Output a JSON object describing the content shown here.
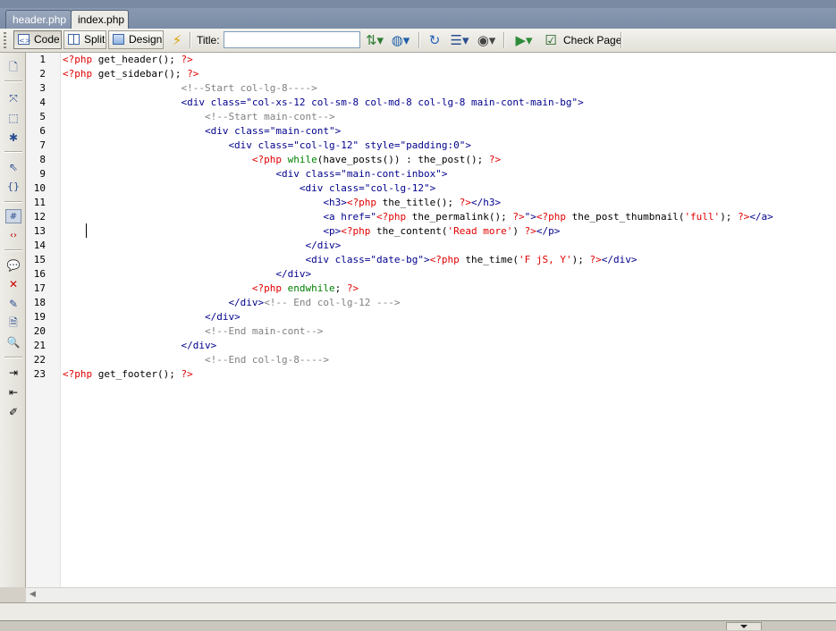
{
  "tabs": [
    {
      "label": "header.php",
      "active": false
    },
    {
      "label": "index.php",
      "active": true
    }
  ],
  "toolbar": {
    "code_label": "Code",
    "split_label": "Split",
    "design_label": "Design",
    "title_label": "Title:",
    "title_value": "",
    "check_page_label": "Check Page",
    "icons": [
      "live-view-icon",
      "file-management-icon",
      "browser-preview-icon",
      "refresh-icon",
      "view-options-icon",
      "visual-aids-icon",
      "validate-icon",
      "check-page-icon"
    ]
  },
  "left_toolbar": {
    "icons": [
      "open-documents-icon",
      "collapse-full-tag-icon",
      "collapse-selection-icon",
      "expand-all-icon",
      "select-parent-tag-icon",
      "balance-braces-icon",
      "line-numbers-icon",
      "highlight-invalid-code-icon",
      "apply-comment-icon",
      "remove-comment-icon",
      "wrap-tag-icon",
      "recent-snippets-icon",
      "move-css-icon",
      "indent-code-icon",
      "outdent-code-icon",
      "format-source-code-icon"
    ]
  },
  "editor": {
    "line_numbers": [
      "1",
      "2",
      "3",
      "4",
      "5",
      "6",
      "7",
      "8",
      "9",
      "10",
      "11",
      "12",
      "13",
      "14",
      "15",
      "16",
      "17",
      "18",
      "19",
      "20",
      "21",
      "22",
      "23"
    ],
    "lines": [
      [
        {
          "t": "php",
          "v": "<?php"
        },
        {
          "t": "plain",
          "v": " get_header(); "
        },
        {
          "t": "php",
          "v": "?>"
        }
      ],
      [
        {
          "t": "php",
          "v": "<?php"
        },
        {
          "t": "plain",
          "v": " get_sidebar(); "
        },
        {
          "t": "php",
          "v": "?>"
        }
      ],
      [
        {
          "t": "plain",
          "v": "                    "
        },
        {
          "t": "cmt",
          "v": "<!--Start col-lg-8---->"
        }
      ],
      [
        {
          "t": "plain",
          "v": "                    "
        },
        {
          "t": "tag",
          "v": "<div class=\"col-xs-12 col-sm-8 col-md-8 col-lg-8 main-cont-main-bg\">"
        }
      ],
      [
        {
          "t": "plain",
          "v": "                        "
        },
        {
          "t": "cmt",
          "v": "<!--Start main-cont-->"
        }
      ],
      [
        {
          "t": "plain",
          "v": "                        "
        },
        {
          "t": "tag",
          "v": "<div class=\"main-cont\">"
        }
      ],
      [
        {
          "t": "plain",
          "v": "                            "
        },
        {
          "t": "tag",
          "v": "<div class=\"col-lg-12\" style=\"padding:0\">"
        }
      ],
      [
        {
          "t": "plain",
          "v": "                                "
        },
        {
          "t": "php",
          "v": "<?php"
        },
        {
          "t": "plain",
          "v": " "
        },
        {
          "t": "kw",
          "v": "while"
        },
        {
          "t": "plain",
          "v": "(have_posts()) : the_post(); "
        },
        {
          "t": "php",
          "v": "?>"
        }
      ],
      [
        {
          "t": "plain",
          "v": "                                    "
        },
        {
          "t": "tag",
          "v": "<div class=\"main-cont-inbox\">"
        }
      ],
      [
        {
          "t": "plain",
          "v": "                                        "
        },
        {
          "t": "tag",
          "v": "<div class=\"col-lg-12\">"
        }
      ],
      [
        {
          "t": "plain",
          "v": "                                            "
        },
        {
          "t": "tag",
          "v": "<h3>"
        },
        {
          "t": "php",
          "v": "<?php"
        },
        {
          "t": "plain",
          "v": " the_title(); "
        },
        {
          "t": "php",
          "v": "?>"
        },
        {
          "t": "tag",
          "v": "</h3>"
        }
      ],
      [
        {
          "t": "plain",
          "v": "                                            "
        },
        {
          "t": "tag",
          "v": "<a href=\""
        },
        {
          "t": "php",
          "v": "<?php"
        },
        {
          "t": "plain",
          "v": " the_permalink(); "
        },
        {
          "t": "php",
          "v": "?>"
        },
        {
          "t": "tag",
          "v": "\">"
        },
        {
          "t": "php",
          "v": "<?php"
        },
        {
          "t": "plain",
          "v": " the_post_thumbnail("
        },
        {
          "t": "php",
          "v": "'full'"
        },
        {
          "t": "plain",
          "v": "); "
        },
        {
          "t": "php",
          "v": "?>"
        },
        {
          "t": "tag",
          "v": "</a>"
        }
      ],
      [
        {
          "t": "plain",
          "v": "                                            "
        },
        {
          "t": "tag",
          "v": "<p>"
        },
        {
          "t": "php",
          "v": "<?php"
        },
        {
          "t": "plain",
          "v": " the_content("
        },
        {
          "t": "php",
          "v": "'Read more'"
        },
        {
          "t": "plain",
          "v": ") "
        },
        {
          "t": "php",
          "v": "?>"
        },
        {
          "t": "tag",
          "v": "</p>"
        }
      ],
      [
        {
          "t": "plain",
          "v": "                                         "
        },
        {
          "t": "tag",
          "v": "</div>"
        }
      ],
      [
        {
          "t": "plain",
          "v": "                                         "
        },
        {
          "t": "tag",
          "v": "<div class=\"date-bg\">"
        },
        {
          "t": "php",
          "v": "<?php"
        },
        {
          "t": "plain",
          "v": " the_time("
        },
        {
          "t": "php",
          "v": "'F jS, Y'"
        },
        {
          "t": "plain",
          "v": "); "
        },
        {
          "t": "php",
          "v": "?>"
        },
        {
          "t": "tag",
          "v": "</div>"
        }
      ],
      [
        {
          "t": "plain",
          "v": "                                    "
        },
        {
          "t": "tag",
          "v": "</div>"
        }
      ],
      [
        {
          "t": "plain",
          "v": "                                "
        },
        {
          "t": "php",
          "v": "<?php"
        },
        {
          "t": "plain",
          "v": " "
        },
        {
          "t": "kw",
          "v": "endwhile"
        },
        {
          "t": "plain",
          "v": "; "
        },
        {
          "t": "php",
          "v": "?>"
        }
      ],
      [
        {
          "t": "plain",
          "v": "                            "
        },
        {
          "t": "tag",
          "v": "</div>"
        },
        {
          "t": "cmt",
          "v": "<!-- End col-lg-12 --->"
        }
      ],
      [
        {
          "t": "plain",
          "v": "                        "
        },
        {
          "t": "tag",
          "v": "</div>"
        }
      ],
      [
        {
          "t": "plain",
          "v": "                        "
        },
        {
          "t": "cmt",
          "v": "<!--End main-cont-->"
        }
      ],
      [
        {
          "t": "plain",
          "v": "                    "
        },
        {
          "t": "tag",
          "v": "</div>"
        }
      ],
      [
        {
          "t": "plain",
          "v": "                        "
        },
        {
          "t": "cmt",
          "v": "<!--End col-lg-8---->"
        }
      ],
      [
        {
          "t": "php",
          "v": "<?php"
        },
        {
          "t": "plain",
          "v": " get_footer(); "
        },
        {
          "t": "php",
          "v": "?>"
        }
      ]
    ]
  },
  "colors": {
    "php": "#e00000",
    "keyword": "#008000",
    "tag": "#00008b",
    "comment": "#808080"
  }
}
